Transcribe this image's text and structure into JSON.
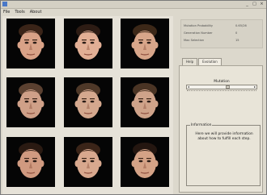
{
  "window": {
    "title": "",
    "controls": [
      "_",
      "□",
      "×"
    ]
  },
  "menu": {
    "items": [
      "File",
      "Tools",
      "About"
    ]
  },
  "faces": [
    {
      "skin": "#d9a287",
      "hair": "#3a2418"
    },
    {
      "skin": "#e2af95",
      "hair": "#2d1c14"
    },
    {
      "skin": "#d8a68a",
      "hair": "#3c2818"
    },
    {
      "skin": "#cfa088",
      "hair": "#5a4030"
    },
    {
      "skin": "#d4a88e",
      "hair": "#4e3828"
    },
    {
      "skin": "#cfa38a",
      "hair": "#4a3424"
    },
    {
      "skin": "#d09a80",
      "hair": "#2a1a12"
    },
    {
      "skin": "#d8a88e",
      "hair": "#3a2418"
    },
    {
      "skin": "#d4a286",
      "hair": "#241610"
    }
  ],
  "stats": {
    "rows": [
      {
        "label": "Mutation Probability",
        "value": "0.65/26"
      },
      {
        "label": "Generation Number",
        "value": "0"
      },
      {
        "label": "Max Selection",
        "value": "15"
      }
    ]
  },
  "tabs": [
    {
      "label": "Help"
    },
    {
      "label": "Evolution"
    }
  ],
  "mutation": {
    "label": "Mutation",
    "level": 0.6
  },
  "info": {
    "title": "Information",
    "text": "Here we will provide information about how to fulfill each step."
  }
}
